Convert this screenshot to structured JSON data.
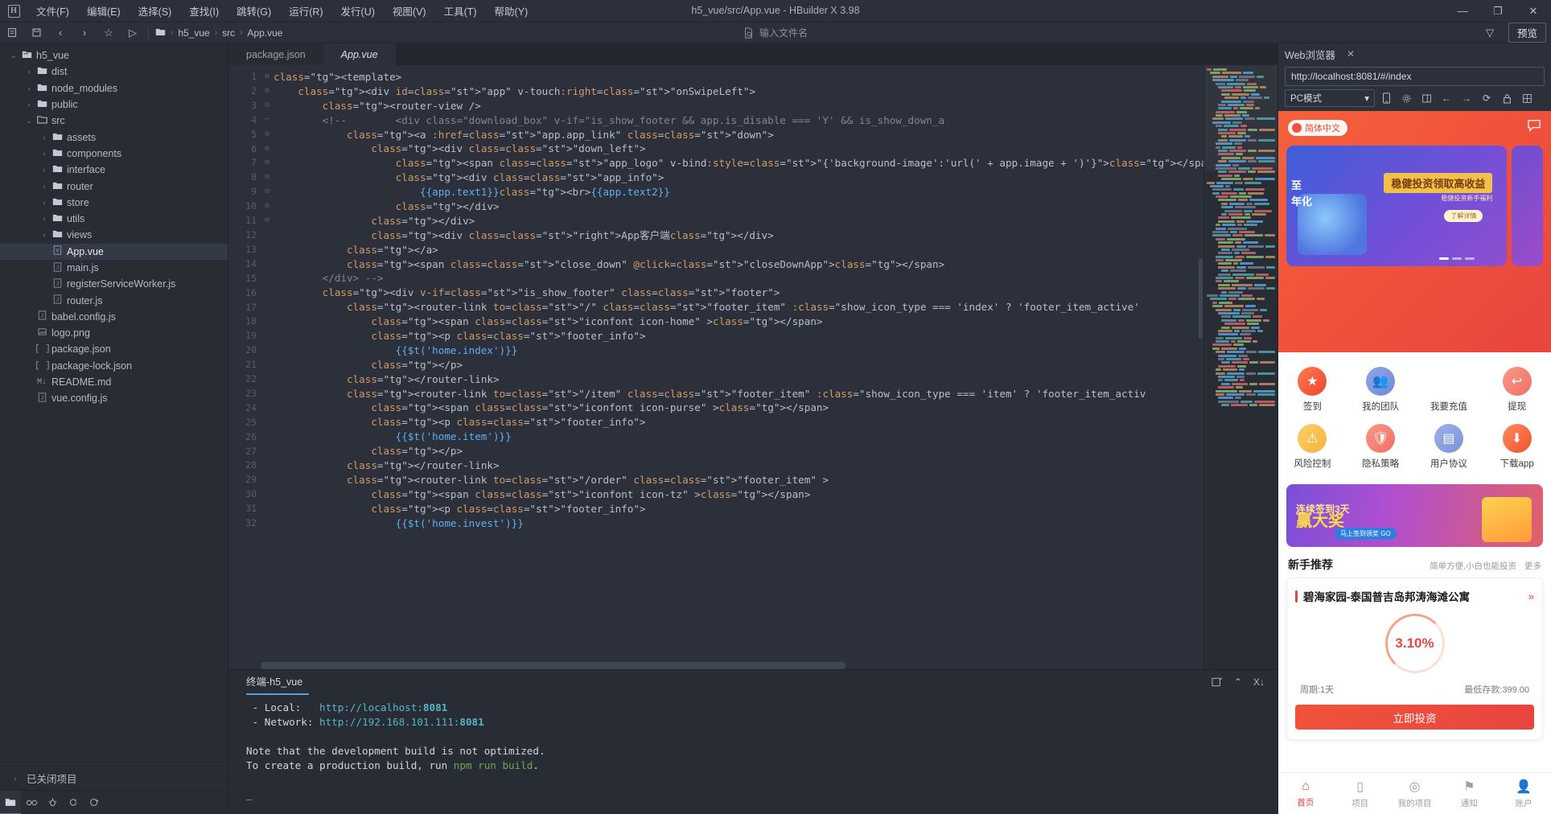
{
  "window": {
    "title": "h5_vue/src/App.vue - HBuilder X 3.98",
    "logo": "H",
    "minimize": "—",
    "maximize": "❐",
    "close": "✕"
  },
  "menu": [
    {
      "label": "文件(F)"
    },
    {
      "label": "编辑(E)"
    },
    {
      "label": "选择(S)"
    },
    {
      "label": "查找(I)"
    },
    {
      "label": "跳转(G)"
    },
    {
      "label": "运行(R)"
    },
    {
      "label": "发行(U)"
    },
    {
      "label": "视图(V)"
    },
    {
      "label": "工具(T)"
    },
    {
      "label": "帮助(Y)"
    }
  ],
  "toolbar": {
    "icons": [
      "新建-icon",
      "保存-icon",
      "后退-icon",
      "前进-icon",
      "收藏-icon",
      "运行-icon"
    ],
    "breadcrumb": [
      "h5_vue",
      "src",
      "App.vue"
    ],
    "file_search_placeholder": "输入文件名",
    "filter_icon": "▽",
    "preview_label": "预览"
  },
  "sidebar": {
    "tree": [
      {
        "label": "h5_vue",
        "depth": 0,
        "type": "project",
        "arrow": "⌄",
        "selected": false
      },
      {
        "label": "dist",
        "depth": 1,
        "type": "folder",
        "arrow": "›",
        "selected": false
      },
      {
        "label": "node_modules",
        "depth": 1,
        "type": "folder",
        "arrow": "›",
        "selected": false
      },
      {
        "label": "public",
        "depth": 1,
        "type": "folder",
        "arrow": "›",
        "selected": false
      },
      {
        "label": "src",
        "depth": 1,
        "type": "folder-open",
        "arrow": "⌄",
        "selected": false
      },
      {
        "label": "assets",
        "depth": 2,
        "type": "folder",
        "arrow": "›",
        "selected": false
      },
      {
        "label": "components",
        "depth": 2,
        "type": "folder",
        "arrow": "›",
        "selected": false
      },
      {
        "label": "interface",
        "depth": 2,
        "type": "folder",
        "arrow": "›",
        "selected": false
      },
      {
        "label": "router",
        "depth": 2,
        "type": "folder",
        "arrow": "›",
        "selected": false
      },
      {
        "label": "store",
        "depth": 2,
        "type": "folder",
        "arrow": "›",
        "selected": false
      },
      {
        "label": "utils",
        "depth": 2,
        "type": "folder",
        "arrow": "›",
        "selected": false
      },
      {
        "label": "views",
        "depth": 2,
        "type": "folder",
        "arrow": "›",
        "selected": false
      },
      {
        "label": "App.vue",
        "depth": 2,
        "type": "vue",
        "arrow": "",
        "selected": true
      },
      {
        "label": "main.js",
        "depth": 2,
        "type": "js",
        "arrow": "",
        "selected": false
      },
      {
        "label": "registerServiceWorker.js",
        "depth": 2,
        "type": "js",
        "arrow": "",
        "selected": false
      },
      {
        "label": "router.js",
        "depth": 2,
        "type": "js",
        "arrow": "",
        "selected": false
      },
      {
        "label": "babel.config.js",
        "depth": 1,
        "type": "js",
        "arrow": "",
        "selected": false
      },
      {
        "label": "logo.png",
        "depth": 1,
        "type": "img",
        "arrow": "",
        "selected": false
      },
      {
        "label": "package.json",
        "depth": 1,
        "type": "json",
        "arrow": "",
        "selected": false
      },
      {
        "label": "package-lock.json",
        "depth": 1,
        "type": "json",
        "arrow": "",
        "selected": false
      },
      {
        "label": "README.md",
        "depth": 1,
        "type": "md",
        "arrow": "",
        "selected": false
      },
      {
        "label": "vue.config.js",
        "depth": 1,
        "type": "js",
        "arrow": "",
        "selected": false
      }
    ],
    "closed_projects": "已关闭项目",
    "closed_projects_arrow": "›",
    "bottom_tabs": [
      "project-icon",
      "search-icon",
      "debug-icon",
      "run-icon",
      "plugin-icon"
    ]
  },
  "editor": {
    "tabs": [
      {
        "label": "package.json",
        "active": false
      },
      {
        "label": "App.vue",
        "active": true
      }
    ],
    "lines": [
      {
        "n": 1,
        "fold": "⊟",
        "text": "<template>"
      },
      {
        "n": 2,
        "fold": "⊟",
        "text": "    <div id=\"app\" v-touch:right=\"onSwipeLeft\">"
      },
      {
        "n": 3,
        "fold": "",
        "text": "        <router-view />"
      },
      {
        "n": 4,
        "fold": "⊟",
        "text": "        <!--        <div class=\"download_box\" v-if=\"is_show_footer && app.is_disable === 'Y' && is_show_down_a"
      },
      {
        "n": 5,
        "fold": "",
        "text": "            <a :href=\"app.app_link\" class=\"down\">"
      },
      {
        "n": 6,
        "fold": "",
        "text": "                <div class=\"down_left\">"
      },
      {
        "n": 7,
        "fold": "",
        "text": "                    <span class=\"app_logo\" v-bind:style=\"{'background-image':'url(' + app.image + ')'}\"></span"
      },
      {
        "n": 8,
        "fold": "",
        "text": "                    <div class=\"app_info\">"
      },
      {
        "n": 9,
        "fold": "",
        "text": "                        {{app.text1}}<br>{{app.text2}}"
      },
      {
        "n": 10,
        "fold": "",
        "text": "                    </div>"
      },
      {
        "n": 11,
        "fold": "",
        "text": "                </div>"
      },
      {
        "n": 12,
        "fold": "",
        "text": "                <div class=\"right\">App客户端</div>"
      },
      {
        "n": 13,
        "fold": "",
        "text": "            </a>"
      },
      {
        "n": 14,
        "fold": "",
        "text": "            <span class=\"close_down\" @click=\"closeDownApp\"></span>"
      },
      {
        "n": 15,
        "fold": "⌐",
        "text": "        </div> -->"
      },
      {
        "n": 16,
        "fold": "⊟",
        "text": "        <div v-if=\"is_show_footer\" class=\"footer\">"
      },
      {
        "n": 17,
        "fold": "⊟",
        "text": "            <router-link to=\"/\" class=\"footer_item\" :class=\"show_icon_type === 'index' ? 'footer_item_active'"
      },
      {
        "n": 18,
        "fold": "",
        "text": "                <span class=\"iconfont icon-home\" ></span>"
      },
      {
        "n": 19,
        "fold": "⊟",
        "text": "                <p class=\"footer_info\">"
      },
      {
        "n": 20,
        "fold": "",
        "text": "                    {{$t('home.index')}}"
      },
      {
        "n": 21,
        "fold": "",
        "text": "                </p>"
      },
      {
        "n": 22,
        "fold": "",
        "text": "            </router-link>"
      },
      {
        "n": 23,
        "fold": "⊟",
        "text": "            <router-link to=\"/item\" class=\"footer_item\" :class=\"show_icon_type === 'item' ? 'footer_item_activ"
      },
      {
        "n": 24,
        "fold": "",
        "text": "                <span class=\"iconfont icon-purse\" ></span>"
      },
      {
        "n": 25,
        "fold": "⊟",
        "text": "                <p class=\"footer_info\">"
      },
      {
        "n": 26,
        "fold": "",
        "text": "                    {{$t('home.item')}}"
      },
      {
        "n": 27,
        "fold": "",
        "text": "                </p>"
      },
      {
        "n": 28,
        "fold": "",
        "text": "            </router-link>"
      },
      {
        "n": 29,
        "fold": "⊟",
        "text": "            <router-link to=\"/order\" class=\"footer_item\" >"
      },
      {
        "n": 30,
        "fold": "",
        "text": "                <span class=\"iconfont icon-tz\" ></span>"
      },
      {
        "n": 31,
        "fold": "⊟",
        "text": "                <p class=\"footer_info\">"
      },
      {
        "n": 32,
        "fold": "",
        "text": "                    {{$t('home.invest')}}"
      }
    ]
  },
  "terminal": {
    "tab": "终端-h5_vue",
    "tools": [
      "new-terminal-icon",
      "collapse-icon",
      "close-all-icon"
    ],
    "lines": [
      " - Local:   http://localhost:8081",
      " - Network: http://192.168.101.111:8081",
      "",
      "Note that the development build is not optimized.",
      "To create a production build, run npm run build.",
      "",
      "_"
    ],
    "local_label": " - Local:",
    "local_url": "http://localhost:",
    "local_port": "8081",
    "network_label": " - Network:",
    "network_url": "http://192.168.101.111:",
    "network_port": "8081",
    "note1": "Note that the development build is not optimized.",
    "note2a": "To create a production build, run ",
    "note2b": "npm run build",
    "note2c": ".",
    "cursor": "_"
  },
  "browser": {
    "panel_title": "Web浏览器",
    "close": "✕",
    "url": "http://localhost:8081/#/index",
    "mode_select": "PC模式",
    "mode_caret": "▾",
    "controls": [
      "mobile-icon",
      "gear-icon",
      "device-icon",
      "back-icon",
      "forward-icon",
      "reload-icon",
      "lock-icon",
      "grid-icon"
    ]
  },
  "mobile": {
    "lang_badge": "简体中文",
    "message_icon": "message-icon",
    "banner": {
      "headline": "稳健投资领取高收益",
      "sub": "稳健投资新手福利",
      "cta": "了解详情",
      "slide2_line1": "至",
      "slide2_line2": "年化"
    },
    "grid": [
      {
        "label": "签到",
        "icon": "star-icon",
        "c1": "#ff7a4d",
        "c2": "#f0442f"
      },
      {
        "label": "我的团队",
        "icon": "team-icon",
        "c1": "#8fa6e8",
        "c2": "#6f8ad8"
      },
      {
        "label": "我要充值",
        "icon": "recharge-icon",
        "c1": "#ffc martin",
        "c2": "#f6a93b"
      },
      {
        "label": "提现",
        "icon": "withdraw-icon",
        "c1": "#f79a8a",
        "c2": "#ef6f63"
      },
      {
        "label": "风险控制",
        "icon": "warning-icon",
        "c1": "#ffd06a",
        "c2": "#f6b23b"
      },
      {
        "label": "隐私策略",
        "icon": "shield-icon",
        "c1": "#f79a8a",
        "c2": "#ef6f63"
      },
      {
        "label": "用户协议",
        "icon": "document-icon",
        "c1": "#9db2e8",
        "c2": "#7c93d8"
      },
      {
        "label": "下载app",
        "icon": "download-icon",
        "c1": "#ff8a5c",
        "c2": "#f0532f"
      }
    ],
    "ad": {
      "line1": "连续签到3天",
      "line2": "赢大奖",
      "btn": "马上签到领奖 GO"
    },
    "section": {
      "title": "新手推荐",
      "sub": "简单方便,小白也能投资",
      "more": "更多"
    },
    "product": {
      "name": "碧海家园-泰国普吉岛邦涛海滩公寓",
      "arrow": "»",
      "rate": "3.10%",
      "period": "周期:1天",
      "minimum": "最低存款:399.00",
      "cta": "立即投资"
    },
    "tabbar": [
      {
        "label": "首页",
        "icon": "home-icon",
        "active": true
      },
      {
        "label": "项目",
        "icon": "project-icon",
        "active": false
      },
      {
        "label": "我的项目",
        "icon": "myitem-icon",
        "active": false
      },
      {
        "label": "通知",
        "icon": "bell-icon",
        "active": false
      },
      {
        "label": "账户",
        "icon": "user-icon",
        "active": false
      }
    ]
  }
}
